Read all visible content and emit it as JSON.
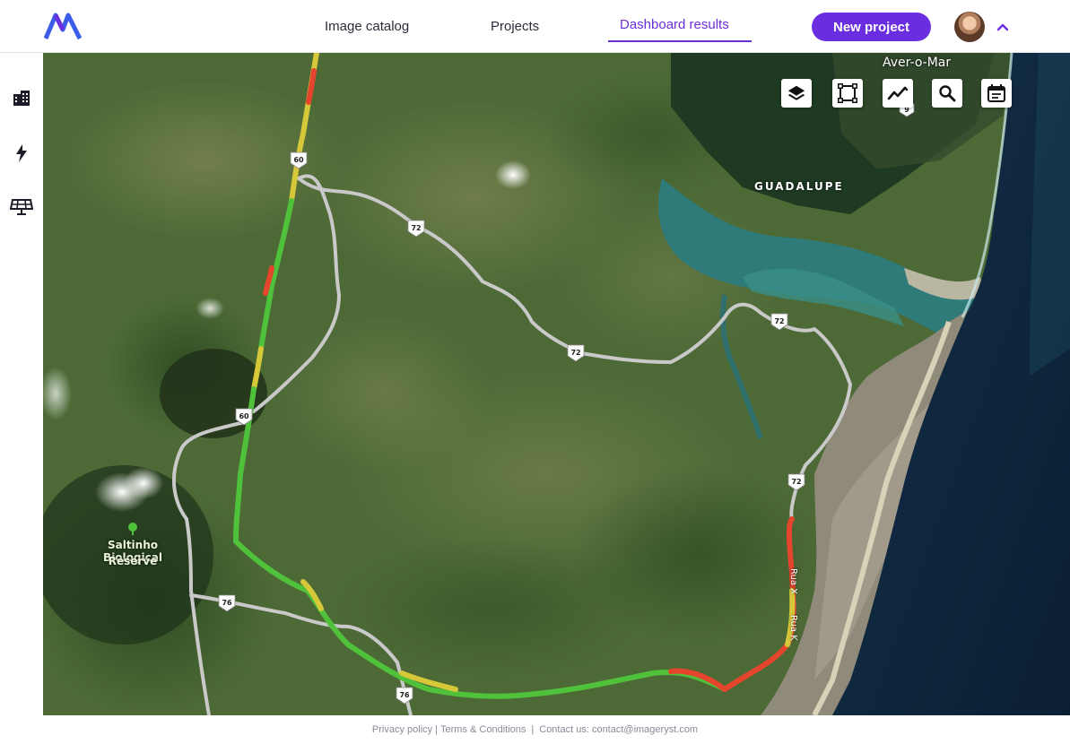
{
  "header": {
    "nav": [
      {
        "label": "Image catalog",
        "active": false
      },
      {
        "label": "Projects",
        "active": false
      },
      {
        "label": "Dashboard results",
        "active": true
      }
    ],
    "new_project_label": "New project",
    "brand_color": "#6a2ee0",
    "logo_icon": "logo-icon",
    "avatar_icon": "user-avatar",
    "menu_toggle_icon": "chevron-up-icon"
  },
  "sidebar": {
    "items": [
      {
        "icon": "buildings-icon"
      },
      {
        "icon": "lightning-bolt-icon"
      },
      {
        "icon": "solar-panel-icon"
      }
    ]
  },
  "map": {
    "tools": [
      {
        "icon": "layers-icon"
      },
      {
        "icon": "select-area-icon"
      },
      {
        "icon": "line-chart-icon"
      },
      {
        "icon": "search-icon"
      },
      {
        "icon": "calendar-icon"
      }
    ],
    "labels": {
      "town_top": "Aver-o-Mar",
      "district": "GUADALUPE",
      "reserve_line1": "Saltinho Biological",
      "reserve_line2": "Reserve",
      "street1": "Rua X",
      "street2": "Rua K"
    },
    "route_shields": [
      "60",
      "72",
      "72",
      "72",
      "60",
      "72",
      "76",
      "76",
      "9"
    ],
    "route_status_colors": {
      "good": "#4fc13b",
      "fair": "#d7c83a",
      "poor": "#e5452c"
    }
  },
  "footer": {
    "privacy": "Privacy policy",
    "sep1": "|",
    "terms": "Terms & Conditions",
    "sep2": "|",
    "contact": "Contact us: contact@imageryst.com"
  }
}
